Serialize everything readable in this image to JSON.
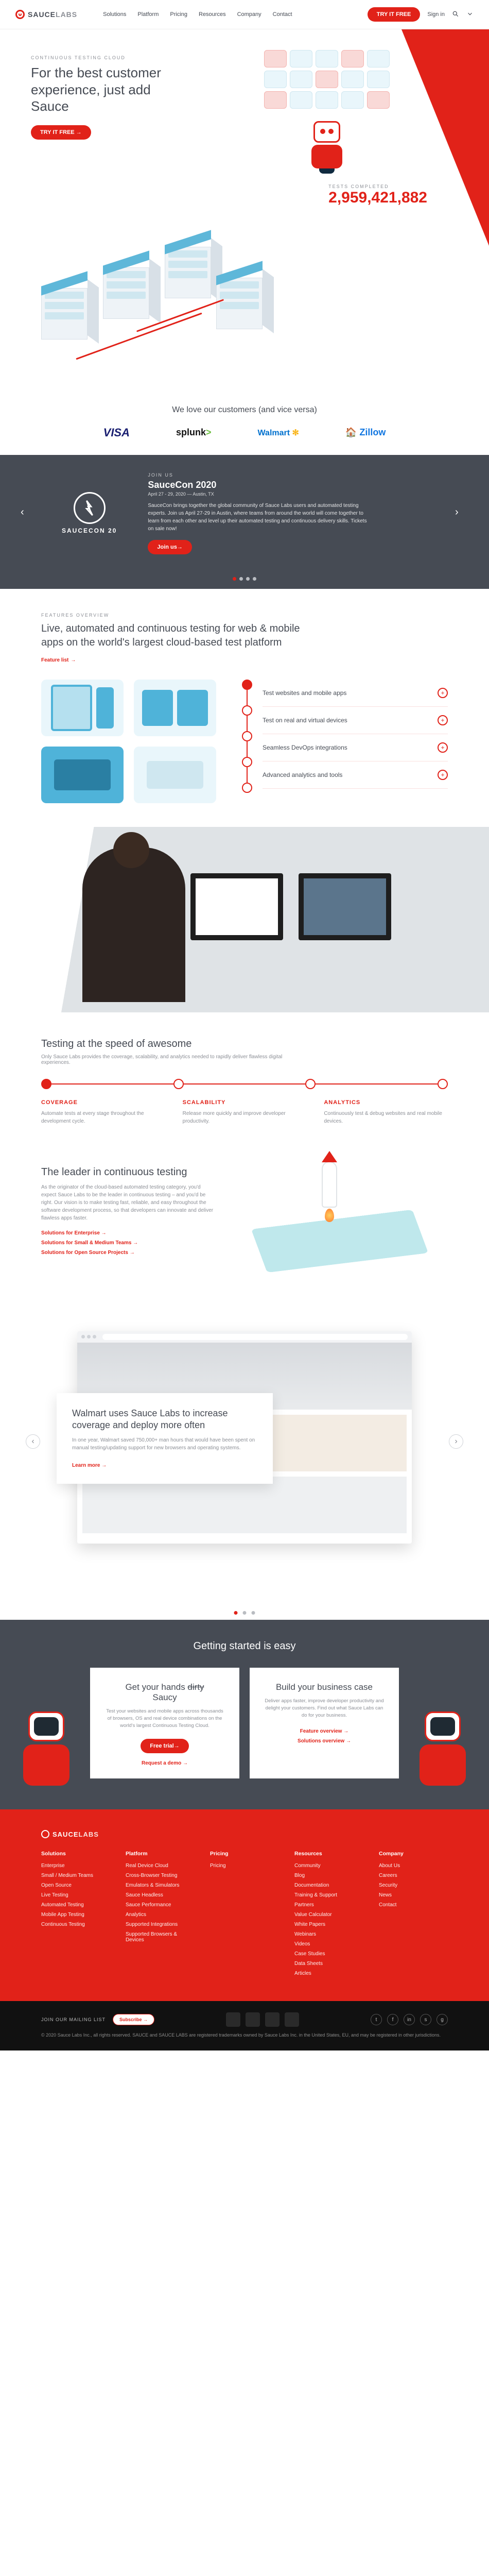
{
  "brand": {
    "name1": "SAUCE",
    "name2": "LABS"
  },
  "nav": {
    "items": [
      "Solutions",
      "Platform",
      "Pricing",
      "Resources",
      "Company",
      "Contact"
    ]
  },
  "header": {
    "try": "TRY IT FREE",
    "signin": "Sign in",
    "search_placeholder": "Search"
  },
  "hero": {
    "eyebrow": "CONTINUOUS TESTING CLOUD",
    "title": "For the best customer experience, just add Sauce",
    "cta": "TRY IT FREE",
    "tests_label": "TESTS COMPLETED",
    "tests_value": "2,959,421,882"
  },
  "customers": {
    "heading": "We love our customers (and vice versa)",
    "logos": {
      "visa": "VISA",
      "splunk": "splunk",
      "walmart": "Walmart",
      "zillow": "Zillow"
    }
  },
  "saucecon": {
    "eyebrow": "JOIN US",
    "title": "SauceCon 2020",
    "date": "April 27 - 29, 2020 — Austin, TX",
    "desc": "SauceCon brings together the global community of Sauce Labs users and automated testing experts. Join us April 27-29 in Austin, where teams from around the world will come together to learn from each other and level up their automated testing and continuous delivery skills. Tickets on sale now!",
    "cta": "Join us",
    "logo_label": "SAUCECON 20"
  },
  "features": {
    "eyebrow": "FEATURES OVERVIEW",
    "heading": "Live, automated and continuous testing for web & mobile apps on the world's largest cloud-based test platform",
    "link": "Feature list",
    "items": [
      "Test websites and mobile apps",
      "Test on real and virtual devices",
      "Seamless DevOps integrations",
      "Advanced analytics and tools"
    ]
  },
  "speed": {
    "heading": "Testing at the speed of awesome",
    "sub": "Only Sauce Labs provides the coverage, scalability, and analytics needed to rapidly deliver flawless digital experiences.",
    "benefits": [
      {
        "title": "COVERAGE",
        "body": "Automate tests at every stage throughout the development cycle."
      },
      {
        "title": "SCALABILITY",
        "body": "Release more quickly and improve developer productivity."
      },
      {
        "title": "ANALYTICS",
        "body": "Continuously test & debug websites and real mobile devices."
      }
    ]
  },
  "leader": {
    "heading": "The leader in continuous testing",
    "body": "As the originator of the cloud-based automated testing category, you'd expect Sauce Labs to be the leader in continuous testing – and you'd be right. Our vision is to make testing fast, reliable, and easy throughout the software development process, so that developers can innovate and deliver flawless apps faster.",
    "links": [
      "Solutions for Enterprise",
      "Solutions for Small & Medium Teams",
      "Solutions for Open Source Projects"
    ]
  },
  "casestudy": {
    "title": "Walmart uses Sauce Labs to increase coverage and deploy more often",
    "body": "In one year, Walmart saved 750,000+ man hours that would have been spent on manual testing/updating support for new browsers and operating systems.",
    "cta": "Learn more"
  },
  "getstart": {
    "heading": "Getting started is easy",
    "card1": {
      "title_a": "Get your hands ",
      "title_strike": "dirty",
      "title_b": "Saucy",
      "body": "Test your websites and mobile apps across thousands of browsers, OS and real device combinations on the world's largest Continuous Testing Cloud.",
      "links": [
        "Free trial",
        "Request a demo"
      ]
    },
    "card2": {
      "title": "Build your business case",
      "body": "Deliver apps faster, improve developer productivity and delight your customers. Find out what Sauce Labs can do for your business.",
      "links": [
        "Feature overview",
        "Solutions overview"
      ]
    }
  },
  "footer": {
    "cols": [
      {
        "h": "Solutions",
        "links": [
          "Enterprise",
          "Small / Medium Teams",
          "Open Source",
          "Live Testing",
          "Automated Testing",
          "Mobile App Testing",
          "Continuous Testing"
        ]
      },
      {
        "h": "Platform",
        "links": [
          "Real Device Cloud",
          "Cross-Browser Testing",
          "Emulators & Simulators",
          "Sauce Headless",
          "Sauce Performance",
          "Analytics",
          "Supported Integrations",
          "Supported Browsers & Devices"
        ]
      },
      {
        "h": "Pricing",
        "links": [
          "Pricing"
        ]
      },
      {
        "h": "Resources",
        "links": [
          "Community",
          "Blog",
          "Documentation",
          "Training & Support",
          "Partners",
          "Value Calculator",
          "White Papers",
          "Webinars",
          "Videos",
          "Case Studies",
          "Data Sheets",
          "Articles"
        ]
      },
      {
        "h": "Company",
        "links": [
          "About Us",
          "Careers",
          "Security",
          "News",
          "Contact"
        ]
      }
    ]
  },
  "subfoot": {
    "label": "JOIN OUR MAILING LIST",
    "copyright": "© 2020 Sauce Labs Inc., all rights reserved. SAUCE and SAUCE LABS are registered trademarks owned by Sauce Labs Inc. in the United States, EU, and may be registered in other jurisdictions."
  }
}
